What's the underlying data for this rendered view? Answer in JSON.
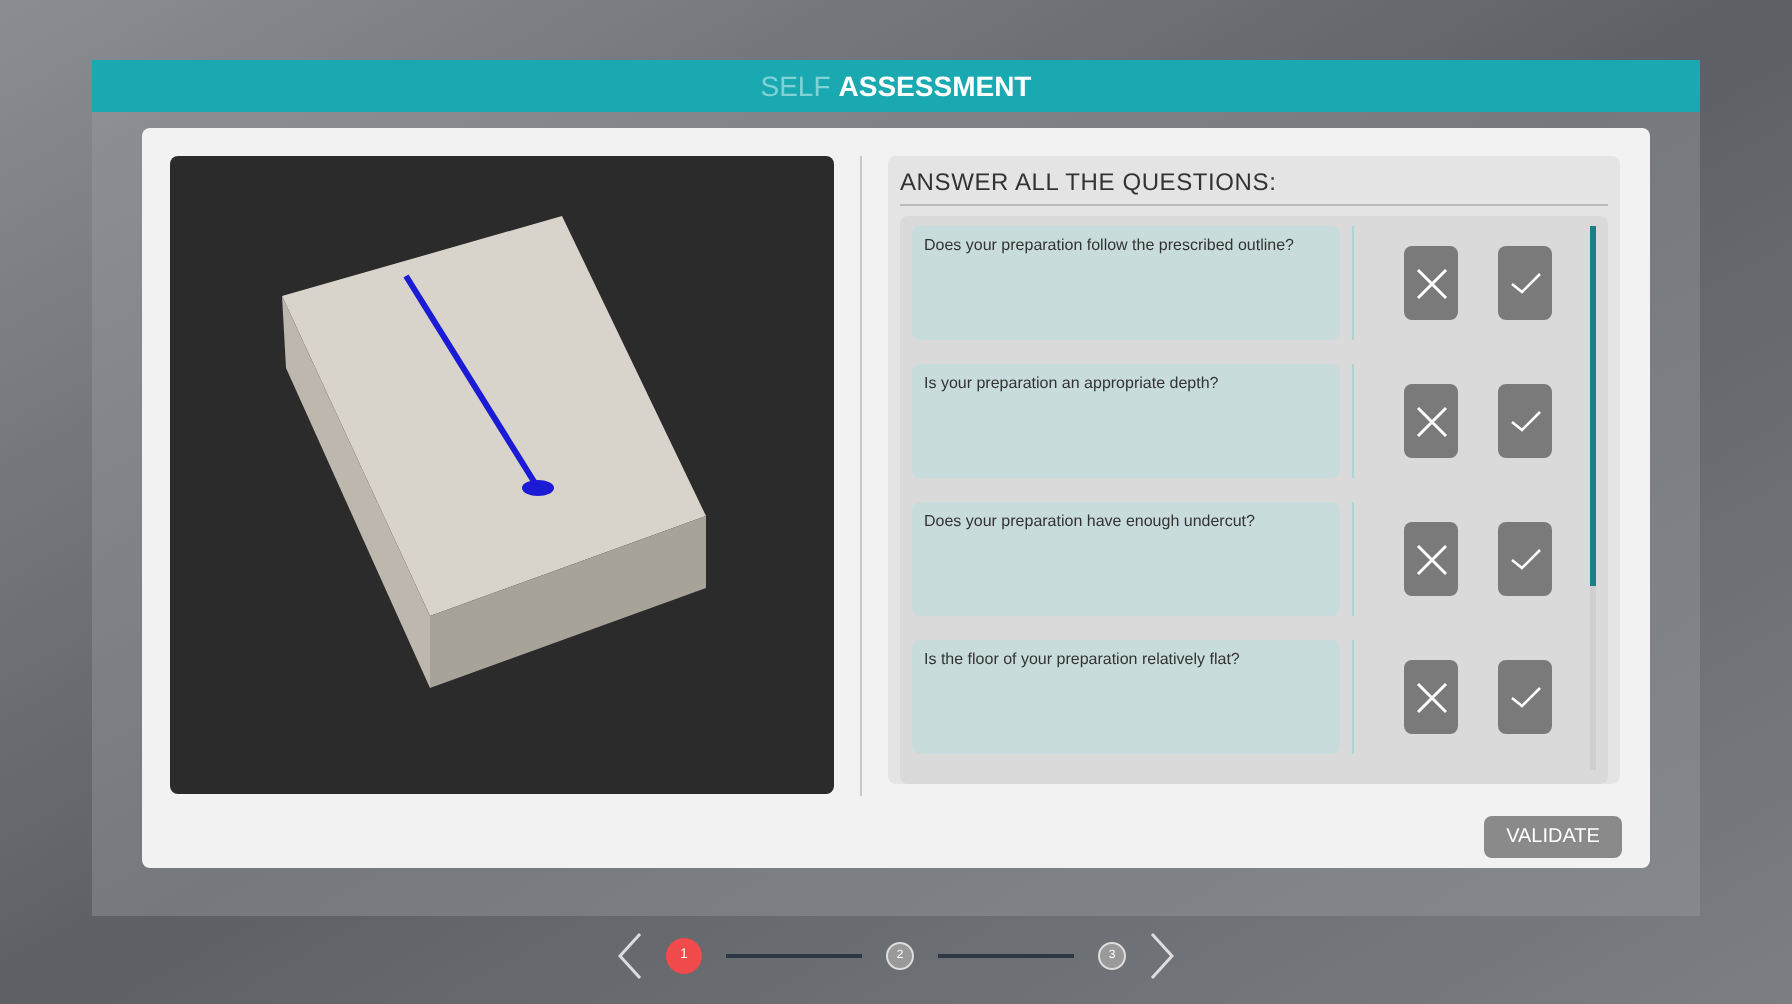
{
  "header": {
    "title_prefix": "SELF",
    "title": "ASSESSMENT"
  },
  "questions_panel": {
    "heading": "ANSWER ALL THE QUESTIONS:",
    "questions": [
      {
        "text": "Does your preparation follow the prescribed outline?"
      },
      {
        "text": "Is your preparation an appropriate depth?"
      },
      {
        "text": "Does your preparation have enough undercut?"
      },
      {
        "text": "Is the floor of your preparation relatively flat?"
      }
    ]
  },
  "validate_button": "VALIDATE",
  "pager": [
    {
      "label": "1",
      "selected": true
    },
    {
      "label": "2",
      "selected": false
    },
    {
      "label": "3",
      "selected": false
    }
  ]
}
